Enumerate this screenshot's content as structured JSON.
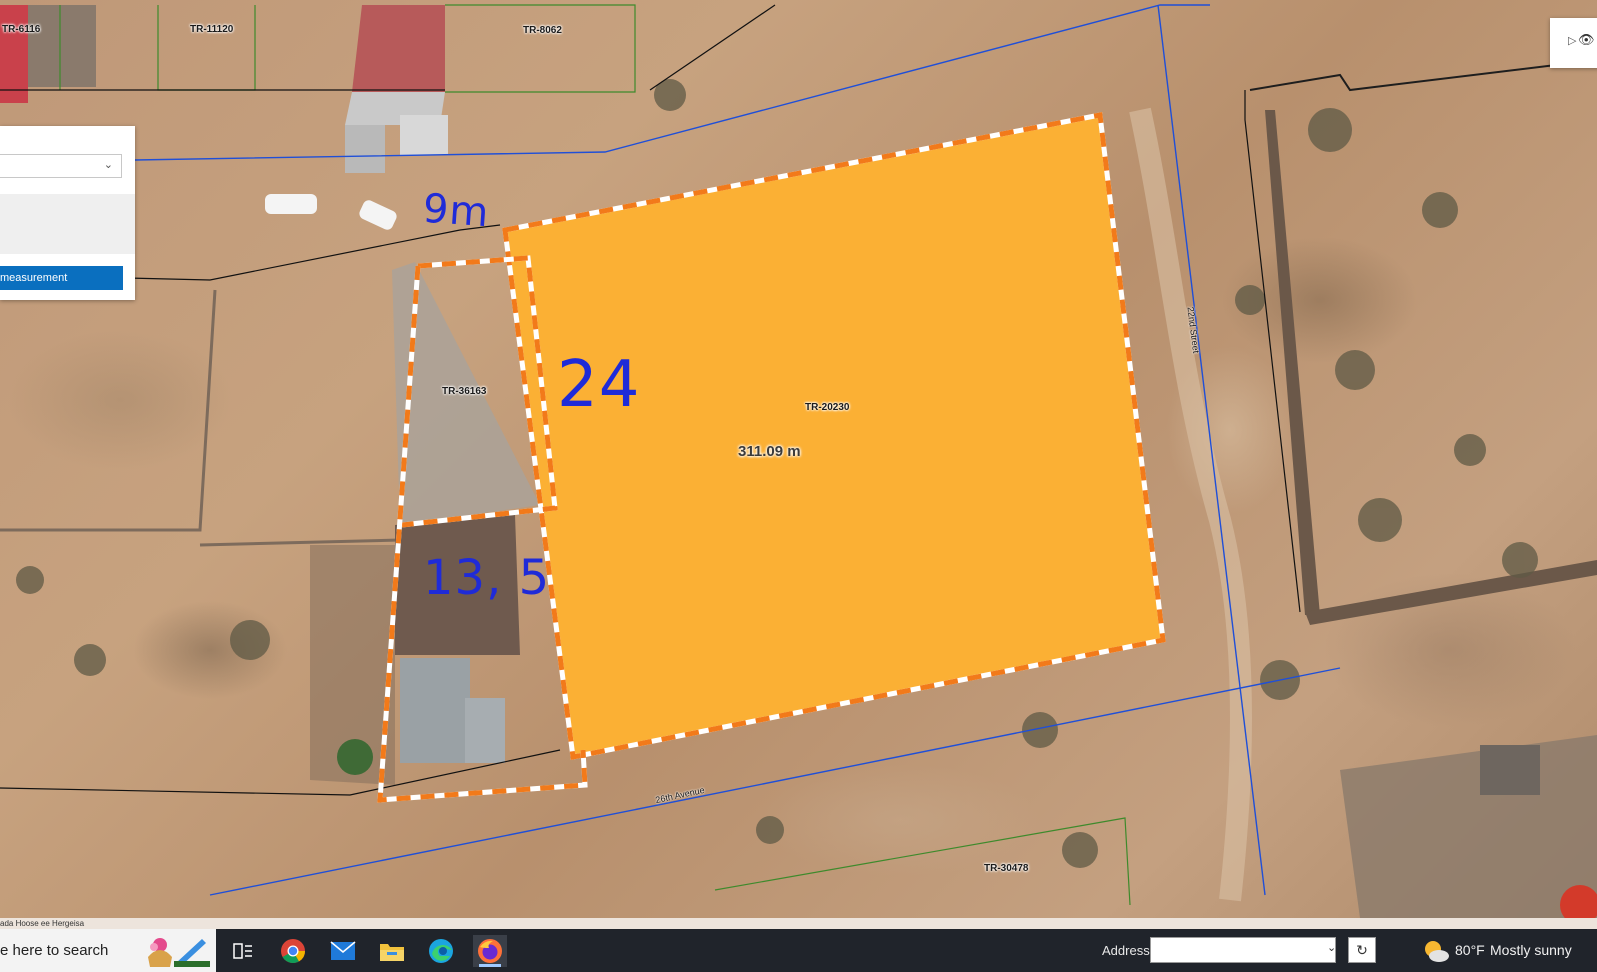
{
  "map": {
    "parcel_labels": {
      "p1": "TR-6116",
      "p2": "TR-11120",
      "p3": "TR-8062",
      "p4": "TR-36163",
      "p5": "TR-20230",
      "p6": "TR-30478"
    },
    "road_labels": {
      "avenue": "26th Avenue",
      "street": "22nd Street"
    },
    "measurement": "311.09 m",
    "annotations": {
      "top": "9m",
      "side": "24",
      "bottom": "13, 5"
    },
    "colors": {
      "parcel_fill": "#fbb034",
      "outline": "#f27a1a",
      "boundary_line": "#1f4fd8",
      "annotation_ink": "#1f2bd8"
    }
  },
  "widget": {
    "button_label": "measurement"
  },
  "attribution": "ada Hoose ee Hergeisa",
  "taskbar": {
    "search_text": "e here to search",
    "address_label": "Address",
    "address_value": "",
    "weather_temp": "80°F",
    "weather_condition": "Mostly sunny",
    "apps": {
      "task_view": "task-view-icon",
      "chrome": "chrome-icon",
      "mail": "mail-icon",
      "explorer": "folder-icon",
      "edge": "edge-icon",
      "firefox": "firefox-icon"
    }
  }
}
